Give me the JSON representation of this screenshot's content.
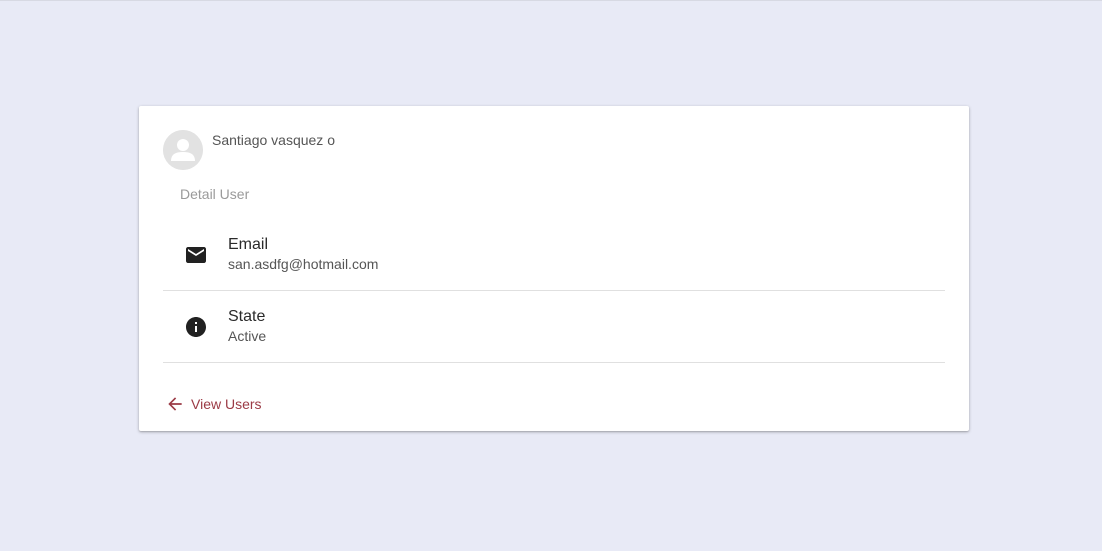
{
  "user": {
    "name": "Santiago vasquez o"
  },
  "detail": {
    "subheader": "Detail User",
    "items": [
      {
        "icon": "mail-icon",
        "title": "Email",
        "value": "san.asdfg@hotmail.com"
      },
      {
        "icon": "info-icon",
        "title": "State",
        "value": "Active"
      }
    ]
  },
  "actions": {
    "back_icon": "arrow-left-icon",
    "back_label": "View Users"
  },
  "colors": {
    "background": "#e8eaf6",
    "card": "#ffffff",
    "link": "#9b3a45",
    "icon": "#212121"
  }
}
